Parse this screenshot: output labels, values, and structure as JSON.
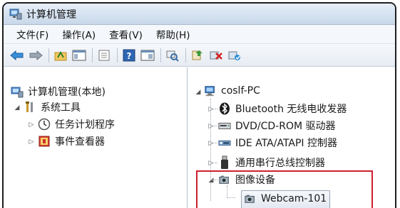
{
  "window": {
    "title": "计算机管理"
  },
  "menu": [
    "文件(F)",
    "操作(A)",
    "查看(V)",
    "帮助(H)"
  ],
  "toolbar": {
    "buttons": [
      "back-arrow-icon",
      "forward-arrow-icon",
      "up-folder-icon",
      "show-hide-tree-icon",
      "properties-icon",
      "help-icon",
      "console-icon",
      "scan-hardware-icon",
      "update-driver-icon",
      "uninstall-icon",
      "enable-device-icon"
    ]
  },
  "left_tree": {
    "root": "计算机管理(本地)",
    "system_tools": "系统工具",
    "task_scheduler": "任务计划程序",
    "event_viewer": "事件查看器"
  },
  "right_tree": {
    "computer": "coslf-PC",
    "bluetooth": "Bluetooth 无线电收发器",
    "dvd": "DVD/CD-ROM 驱动器",
    "ide": "IDE ATA/ATAPI 控制器",
    "usb": "通用串行总线控制器",
    "imaging": "图像设备",
    "webcam": "Webcam-101"
  },
  "colors": {
    "highlight": "#cf1f2e",
    "titlebar": "#c9d8ea"
  }
}
